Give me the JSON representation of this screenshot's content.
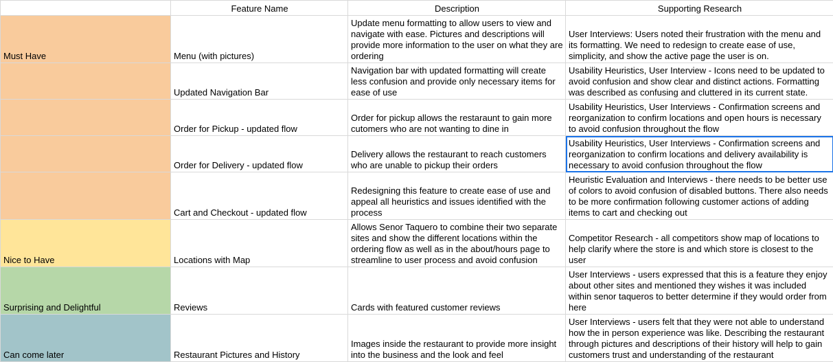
{
  "headers": {
    "category": "",
    "feature": "Feature Name",
    "description": "Description",
    "research": "Supporting Research"
  },
  "colors": {
    "must_have": "#f9cb9c",
    "nice_to_have": "#ffe599",
    "surprising": "#b6d7a8",
    "can_come_later": "#a2c4c9",
    "selection": "#1a73e8",
    "gridline": "#d9d9d9"
  },
  "rows": [
    {
      "category": "Must Have",
      "feature": "Menu (with pictures)",
      "description": "Update menu formatting to allow users to view and navigate with ease. Pictures and descriptions will provide more information to the user on what they are ordering",
      "research": "User Interviews: Users noted their frustration with the menu and its formatting. We need to redesign to create ease of use, simplicity, and show the active page the user is on."
    },
    {
      "category": "",
      "feature": "Updated Navigation Bar",
      "description": "Navigation bar with updated formatting will create less confusion and provide only necessary items for ease of use",
      "research": "Usability Heuristics, User Interview - Icons need to be updated to avoid confusion and show clear and distinct actions. Formatting was described as confusing and cluttered in its current state."
    },
    {
      "category": "",
      "feature": "Order for Pickup - updated flow",
      "description": "Order for pickup allows the restaraunt to gain more cutomers who are not wanting to dine in",
      "research": "Usability Heuristics, User Interviews - Confirmation screens and reorganization to confirm locations and open hours is necessary to avoid confusion throughout the flow"
    },
    {
      "category": "",
      "feature": "Order for Delivery - updated flow",
      "description": "Delivery allows the restaurant to reach customers who are unable to pickup their orders",
      "research": "Usability Heuristics, User Interviews - Confirmation screens and reorganization to confirm locations and delivery availability is necessary to avoid confusion throughout the flow"
    },
    {
      "category": "",
      "feature": "Cart and Checkout - updated flow",
      "description": "Redesigning this feature to create ease of use and appeal all heuristics and issues identified with the process",
      "research": "Heuristic Evaluation and Interviews - there needs to be better use of colors to avoid confusion of disabled buttons. There also needs to be more confirmation following customer actions of adding items to cart and checking out"
    },
    {
      "category": "Nice to Have",
      "feature": "Locations with Map",
      "description": "Allows Senor Taquero to combine their two separate sites and show the different locations within the ordering flow as well as in the about/hours page to streamline to user process and avoid confusion",
      "research": "Competitor Research - all competitors show map of locations to help clarify where the store is and which store is closest to the user"
    },
    {
      "category": "Surprising and Delightful",
      "feature": "Reviews",
      "description": "Cards with featured customer reviews",
      "research": "User Interviews - users expressed that this is a feature they enjoy about other sites and mentioned they wishes it was included within senor taqueros to better determine if they would order from here"
    },
    {
      "category": "Can come later",
      "feature": "Restaurant Pictures and History",
      "description": "Images inside the restaurant to provide more insight into the business and the look and feel",
      "research": "User Interviews - users felt that they were not able to understand how the in person experience was like. Describing the restaurant through pictures and descriptions of their history will help to gain customers trust and understanding of the restaurant"
    }
  ]
}
